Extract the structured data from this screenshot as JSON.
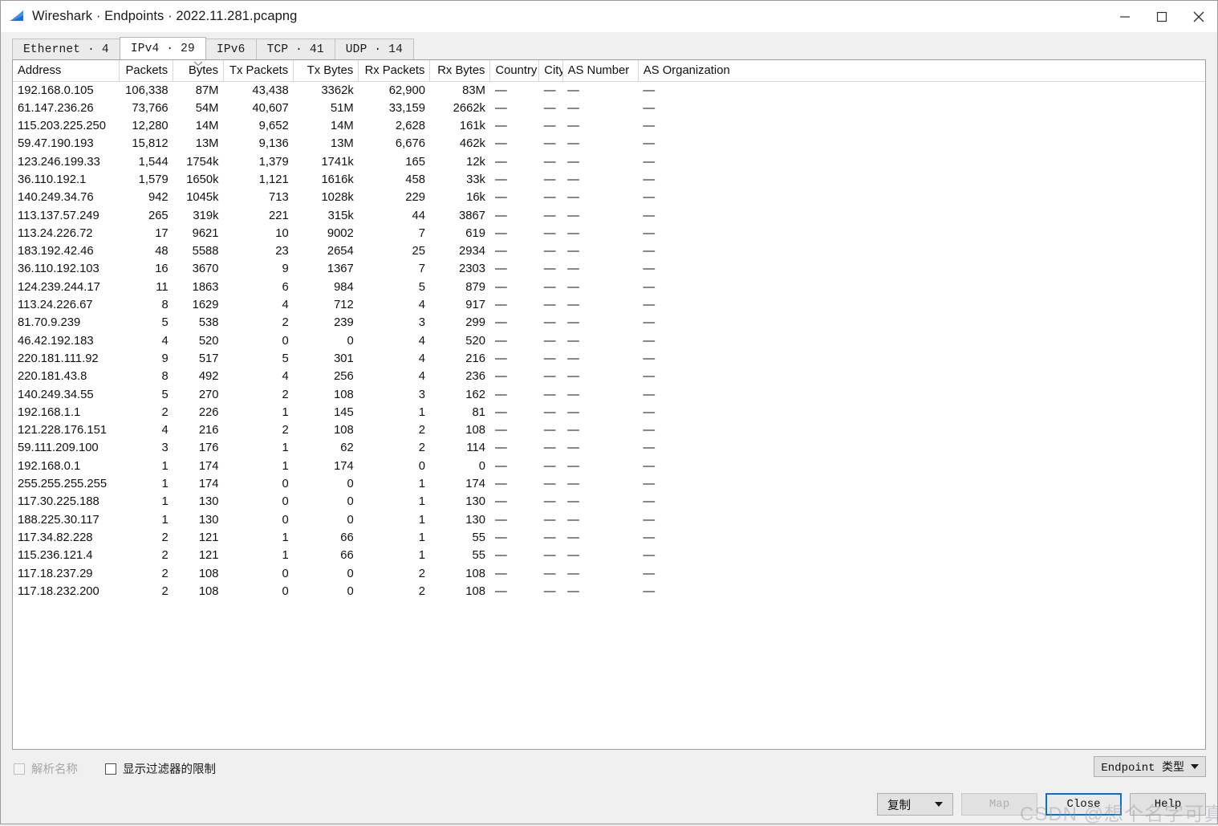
{
  "window": {
    "title": "Wireshark · Endpoints · 2022.11.281.pcapng",
    "app_icon": "wireshark-fin-icon",
    "controls": {
      "minimize": "minimize-icon",
      "maximize": "maximize-icon",
      "close": "close-icon"
    }
  },
  "tabs": [
    {
      "label": "Ethernet · 4",
      "active": false
    },
    {
      "label": "IPv4 · 29",
      "active": true
    },
    {
      "label": "IPv6",
      "active": false
    },
    {
      "label": "TCP · 41",
      "active": false
    },
    {
      "label": "UDP · 14",
      "active": false
    }
  ],
  "table": {
    "sort_column": "Bytes",
    "sort_direction": "descending",
    "columns": [
      {
        "label": "Address",
        "align": "left"
      },
      {
        "label": "Packets",
        "align": "right"
      },
      {
        "label": "Bytes",
        "align": "right"
      },
      {
        "label": "Tx Packets",
        "align": "right"
      },
      {
        "label": "Tx Bytes",
        "align": "right"
      },
      {
        "label": "Rx Packets",
        "align": "right"
      },
      {
        "label": "Rx Bytes",
        "align": "right"
      },
      {
        "label": "Country",
        "align": "left"
      },
      {
        "label": "City",
        "align": "left"
      },
      {
        "label": "AS Number",
        "align": "left"
      },
      {
        "label": "AS Organization",
        "align": "left"
      }
    ],
    "rows": [
      [
        "192.168.0.105",
        "106,338",
        "87M",
        "43,438",
        "3362k",
        "62,900",
        "83M",
        "—",
        "—",
        "—",
        "—"
      ],
      [
        "61.147.236.26",
        "73,766",
        "54M",
        "40,607",
        "51M",
        "33,159",
        "2662k",
        "—",
        "—",
        "—",
        "—"
      ],
      [
        "115.203.225.250",
        "12,280",
        "14M",
        "9,652",
        "14M",
        "2,628",
        "161k",
        "—",
        "—",
        "—",
        "—"
      ],
      [
        "59.47.190.193",
        "15,812",
        "13M",
        "9,136",
        "13M",
        "6,676",
        "462k",
        "—",
        "—",
        "—",
        "—"
      ],
      [
        "123.246.199.33",
        "1,544",
        "1754k",
        "1,379",
        "1741k",
        "165",
        "12k",
        "—",
        "—",
        "—",
        "—"
      ],
      [
        "36.110.192.1",
        "1,579",
        "1650k",
        "1,121",
        "1616k",
        "458",
        "33k",
        "—",
        "—",
        "—",
        "—"
      ],
      [
        "140.249.34.76",
        "942",
        "1045k",
        "713",
        "1028k",
        "229",
        "16k",
        "—",
        "—",
        "—",
        "—"
      ],
      [
        "113.137.57.249",
        "265",
        "319k",
        "221",
        "315k",
        "44",
        "3867",
        "—",
        "—",
        "—",
        "—"
      ],
      [
        "113.24.226.72",
        "17",
        "9621",
        "10",
        "9002",
        "7",
        "619",
        "—",
        "—",
        "—",
        "—"
      ],
      [
        "183.192.42.46",
        "48",
        "5588",
        "23",
        "2654",
        "25",
        "2934",
        "—",
        "—",
        "—",
        "—"
      ],
      [
        "36.110.192.103",
        "16",
        "3670",
        "9",
        "1367",
        "7",
        "2303",
        "—",
        "—",
        "—",
        "—"
      ],
      [
        "124.239.244.17",
        "11",
        "1863",
        "6",
        "984",
        "5",
        "879",
        "—",
        "—",
        "—",
        "—"
      ],
      [
        "113.24.226.67",
        "8",
        "1629",
        "4",
        "712",
        "4",
        "917",
        "—",
        "—",
        "—",
        "—"
      ],
      [
        "81.70.9.239",
        "5",
        "538",
        "2",
        "239",
        "3",
        "299",
        "—",
        "—",
        "—",
        "—"
      ],
      [
        "46.42.192.183",
        "4",
        "520",
        "0",
        "0",
        "4",
        "520",
        "—",
        "—",
        "—",
        "—"
      ],
      [
        "220.181.111.92",
        "9",
        "517",
        "5",
        "301",
        "4",
        "216",
        "—",
        "—",
        "—",
        "—"
      ],
      [
        "220.181.43.8",
        "8",
        "492",
        "4",
        "256",
        "4",
        "236",
        "—",
        "—",
        "—",
        "—"
      ],
      [
        "140.249.34.55",
        "5",
        "270",
        "2",
        "108",
        "3",
        "162",
        "—",
        "—",
        "—",
        "—"
      ],
      [
        "192.168.1.1",
        "2",
        "226",
        "1",
        "145",
        "1",
        "81",
        "—",
        "—",
        "—",
        "—"
      ],
      [
        "121.228.176.151",
        "4",
        "216",
        "2",
        "108",
        "2",
        "108",
        "—",
        "—",
        "—",
        "—"
      ],
      [
        "59.111.209.100",
        "3",
        "176",
        "1",
        "62",
        "2",
        "114",
        "—",
        "—",
        "—",
        "—"
      ],
      [
        "192.168.0.1",
        "1",
        "174",
        "1",
        "174",
        "0",
        "0",
        "—",
        "—",
        "—",
        "—"
      ],
      [
        "255.255.255.255",
        "1",
        "174",
        "0",
        "0",
        "1",
        "174",
        "—",
        "—",
        "—",
        "—"
      ],
      [
        "117.30.225.188",
        "1",
        "130",
        "0",
        "0",
        "1",
        "130",
        "—",
        "—",
        "—",
        "—"
      ],
      [
        "188.225.30.117",
        "1",
        "130",
        "0",
        "0",
        "1",
        "130",
        "—",
        "—",
        "—",
        "—"
      ],
      [
        "117.34.82.228",
        "2",
        "121",
        "1",
        "66",
        "1",
        "55",
        "—",
        "—",
        "—",
        "—"
      ],
      [
        "115.236.121.4",
        "2",
        "121",
        "1",
        "66",
        "1",
        "55",
        "—",
        "—",
        "—",
        "—"
      ],
      [
        "117.18.237.29",
        "2",
        "108",
        "0",
        "0",
        "2",
        "108",
        "—",
        "—",
        "—",
        "—"
      ],
      [
        "117.18.232.200",
        "2",
        "108",
        "0",
        "0",
        "2",
        "108",
        "—",
        "—",
        "—",
        "—"
      ]
    ]
  },
  "footer": {
    "checkboxes": [
      {
        "label": "解析名称",
        "checked": false,
        "disabled": true
      },
      {
        "label": "显示过滤器的限制",
        "checked": false,
        "disabled": false
      }
    ],
    "endpoint_type_label": "Endpoint 类型",
    "buttons": {
      "copy": "复制",
      "map": "Map",
      "close": "Close",
      "help": "Help"
    }
  },
  "watermark": "CSDN @想个名字可真费劲"
}
